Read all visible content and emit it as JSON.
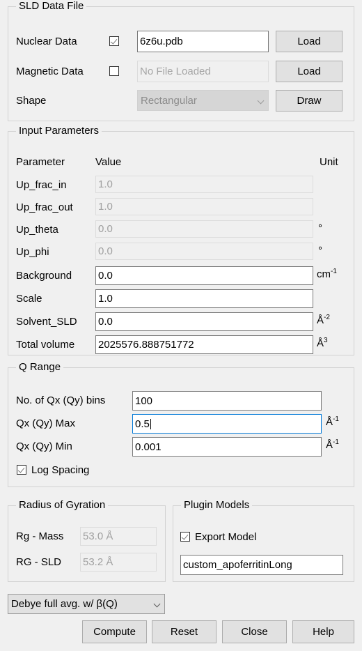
{
  "sld_group": {
    "title": "SLD Data File",
    "nuclear": {
      "label": "Nuclear Data",
      "checked": true,
      "value": "6z6u.pdb",
      "button": "Load"
    },
    "magnetic": {
      "label": "Magnetic Data",
      "checked": false,
      "placeholder": "No File Loaded",
      "button": "Load"
    },
    "shape": {
      "label": "Shape",
      "value": "Rectangular",
      "button": "Draw"
    }
  },
  "input_group": {
    "title": "Input Parameters",
    "columns": {
      "parameter": "Parameter",
      "value": "Value",
      "unit": "Unit"
    },
    "rows": [
      {
        "label": "Up_frac_in",
        "value": "1.0",
        "unit": "",
        "unit_sup": "",
        "disabled": true
      },
      {
        "label": "Up_frac_out",
        "value": "1.0",
        "unit": "",
        "unit_sup": "",
        "disabled": true
      },
      {
        "label": "Up_theta",
        "value": "0.0",
        "unit": "°",
        "unit_sup": "",
        "disabled": true
      },
      {
        "label": "Up_phi",
        "value": "0.0",
        "unit": "°",
        "unit_sup": "",
        "disabled": true
      },
      {
        "label": "Background",
        "value": "0.0",
        "unit": "cm",
        "unit_sup": "-1",
        "disabled": false
      },
      {
        "label": "Scale",
        "value": "1.0",
        "unit": "",
        "unit_sup": "",
        "disabled": false
      },
      {
        "label": "Solvent_SLD",
        "value": "0.0",
        "unit": "Å",
        "unit_sup": "-2",
        "disabled": false
      },
      {
        "label": "Total volume",
        "value": "2025576.888751772",
        "unit": "Å",
        "unit_sup": "3",
        "disabled": false
      }
    ]
  },
  "q_group": {
    "title": "Q Range",
    "bins": {
      "label": "No. of Qx (Qy) bins",
      "value": "100",
      "unit": "",
      "unit_sup": ""
    },
    "qmax": {
      "label": "Qx (Qy) Max",
      "value": "0.5",
      "unit": "Å",
      "unit_sup": "-1",
      "focused": true
    },
    "qmin": {
      "label": "Qx (Qy) Min",
      "value": "0.001",
      "unit": "Å",
      "unit_sup": "-1"
    },
    "log_spacing": {
      "label": "Log Spacing",
      "checked": true
    }
  },
  "rg_group": {
    "title": "Radius of Gyration",
    "mass": {
      "label": "Rg - Mass",
      "value": "53.0 Å"
    },
    "sld": {
      "label": "RG - SLD",
      "value": "53.2 Å"
    }
  },
  "plugin_group": {
    "title": "Plugin Models",
    "export": {
      "label": "Export Model",
      "checked": true
    },
    "model_name": "custom_apoferritinLong"
  },
  "bottom": {
    "averaging": "Debye full avg. w/ β(Q)",
    "buttons": {
      "compute": "Compute",
      "reset": "Reset",
      "close": "Close",
      "help": "Help"
    }
  },
  "colors": {
    "window_bg": "#f0f0f0",
    "focus_border": "#0078d7",
    "field_border": "#7a7a7a",
    "button_bg": "#e1e1e1",
    "disabled_text": "#a0a0a0"
  }
}
